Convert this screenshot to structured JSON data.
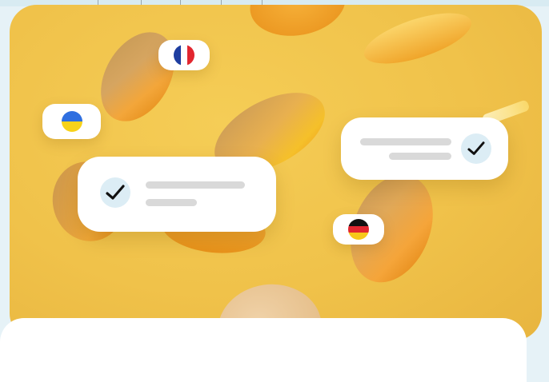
{
  "colors": {
    "page_bg": "#e6f2f7",
    "hero_bg": "#f0c24a",
    "coin": "#f5a623",
    "card_bg": "#ffffff",
    "check_bg": "#dcedf5",
    "placeholder_bar": "#d9d9d9"
  },
  "flags": [
    {
      "country": "france",
      "icon": "france-flag-icon"
    },
    {
      "country": "ukraine",
      "icon": "ukraine-flag-icon"
    },
    {
      "country": "germany",
      "icon": "germany-flag-icon"
    }
  ],
  "confirmation_cards": [
    {
      "icon": "checkmark-icon",
      "status": "confirmed"
    },
    {
      "icon": "checkmark-icon",
      "status": "confirmed"
    }
  ]
}
